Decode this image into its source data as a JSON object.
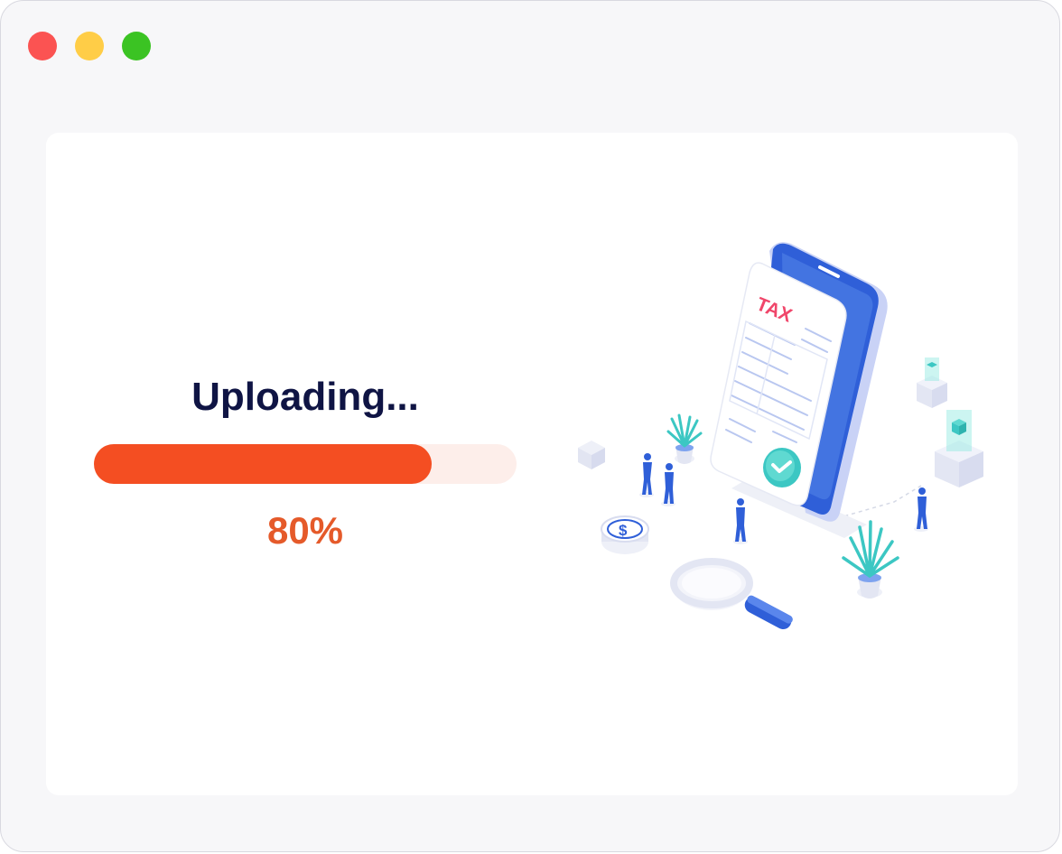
{
  "window": {
    "controls": [
      {
        "name": "close",
        "color": "#fb5352"
      },
      {
        "name": "minimize",
        "color": "#ffcd47"
      },
      {
        "name": "maximize",
        "color": "#3bc323"
      }
    ]
  },
  "upload": {
    "title": "Uploading...",
    "progress": 0.8,
    "percent_label": "80%"
  },
  "illustration": {
    "document_label": "TAX",
    "icons": [
      "phone-icon",
      "tax-document-icon",
      "checkmark-icon",
      "magnifier-icon",
      "dollar-coin-icon",
      "plant-icon",
      "person-icon",
      "cube-icon"
    ]
  },
  "colors": {
    "title": "#0f1444",
    "progress_fill": "#f44e22",
    "progress_track": "#fdeeea",
    "percent": "#e55a2a",
    "accent_red": "#f0466a",
    "phone_blue": "#2f5fd8",
    "teal": "#3cc7c3"
  }
}
